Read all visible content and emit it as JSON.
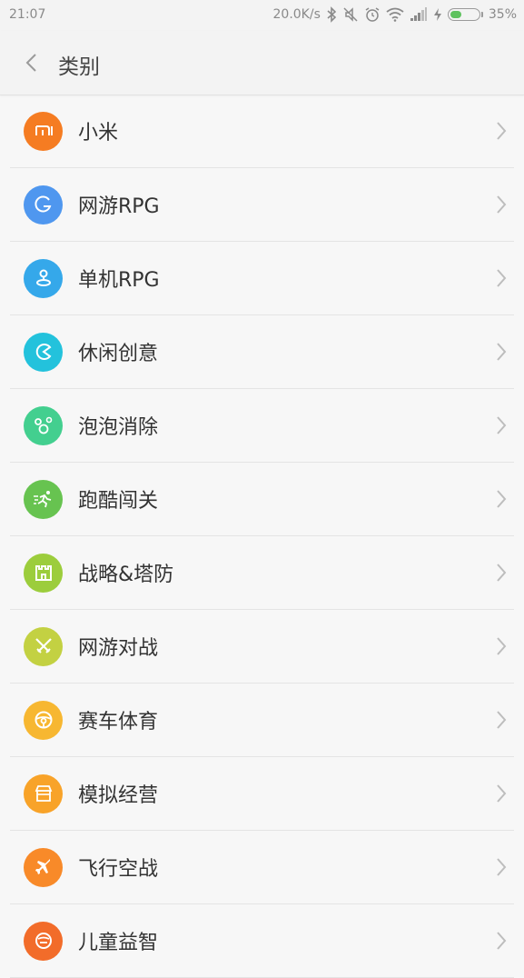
{
  "status_bar": {
    "time": "21:07",
    "net_speed": "20.0K/s",
    "battery_percent": "35%",
    "icons": [
      "bluetooth-icon",
      "mute-icon",
      "alarm-icon",
      "wifi-icon",
      "signal-icon",
      "charging-icon",
      "battery-icon"
    ]
  },
  "header": {
    "title": "类别",
    "back_icon": "chevron-left-icon"
  },
  "categories": [
    {
      "label": "小米",
      "color": "#f57c22",
      "icon": "mi-logo-icon"
    },
    {
      "label": "网游RPG",
      "color": "#4f97ef",
      "icon": "g-letter-icon"
    },
    {
      "label": "单机RPG",
      "color": "#35a8ea",
      "icon": "joystick-icon"
    },
    {
      "label": "休闲创意",
      "color": "#23c2dc",
      "icon": "pacman-icon"
    },
    {
      "label": "泡泡消除",
      "color": "#43cf8f",
      "icon": "bubbles-icon"
    },
    {
      "label": "跑酷闯关",
      "color": "#67c350",
      "icon": "runner-icon"
    },
    {
      "label": "战略&塔防",
      "color": "#9ccd3c",
      "icon": "castle-icon"
    },
    {
      "label": "网游对战",
      "color": "#c3d142",
      "icon": "crossed-swords-icon"
    },
    {
      "label": "赛车体育",
      "color": "#f7b731",
      "icon": "steering-wheel-icon"
    },
    {
      "label": "模拟经营",
      "color": "#f8a329",
      "icon": "shop-icon"
    },
    {
      "label": "飞行空战",
      "color": "#f88a29",
      "icon": "airplane-icon"
    },
    {
      "label": "儿童益智",
      "color": "#f26c2a",
      "icon": "puzzle-icon"
    }
  ]
}
